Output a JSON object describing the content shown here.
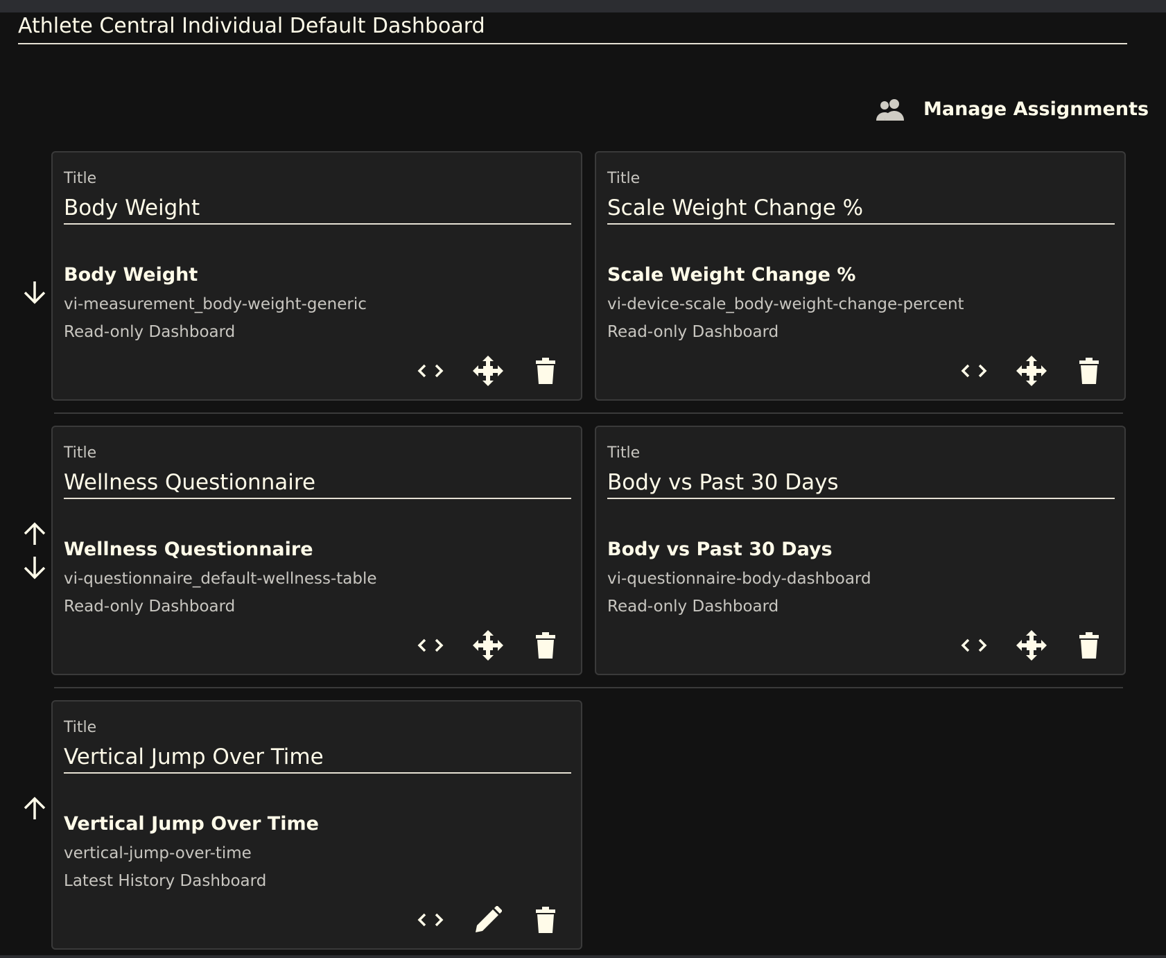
{
  "page": {
    "title": "Athlete Central Individual Default Dashboard"
  },
  "header": {
    "manage_assignments_label": "Manage Assignments"
  },
  "field_label": "Title",
  "widgets": [
    {
      "title_value": "Body Weight",
      "name": "Body Weight",
      "slug": "vi-measurement_body-weight-generic",
      "type": "Read-only Dashboard",
      "middle_action": "move"
    },
    {
      "title_value": "Scale Weight Change %",
      "name": "Scale Weight Change %",
      "slug": "vi-device-scale_body-weight-change-percent",
      "type": "Read-only Dashboard",
      "middle_action": "move"
    },
    {
      "title_value": "Wellness Questionnaire",
      "name": "Wellness Questionnaire",
      "slug": "vi-questionnaire_default-wellness-table",
      "type": "Read-only Dashboard",
      "middle_action": "move"
    },
    {
      "title_value": "Body vs Past 30 Days",
      "name": "Body vs Past 30 Days",
      "slug": "vi-questionnaire-body-dashboard",
      "type": "Read-only Dashboard",
      "middle_action": "move"
    },
    {
      "title_value": "Vertical Jump Over Time",
      "name": "Vertical Jump Over Time",
      "slug": "vertical-jump-over-time",
      "type": "Latest History Dashboard",
      "middle_action": "edit"
    }
  ],
  "icons": {
    "manage": "people-icon",
    "code": "code-icon",
    "move": "move-icon",
    "edit": "pencil-icon",
    "delete": "trash-icon",
    "up": "arrow-up-icon",
    "down": "arrow-down-icon"
  },
  "colors": {
    "background": "#121212",
    "card": "#1f1f1f",
    "text": "#fffbe9",
    "muted": "#c8c6c0"
  }
}
